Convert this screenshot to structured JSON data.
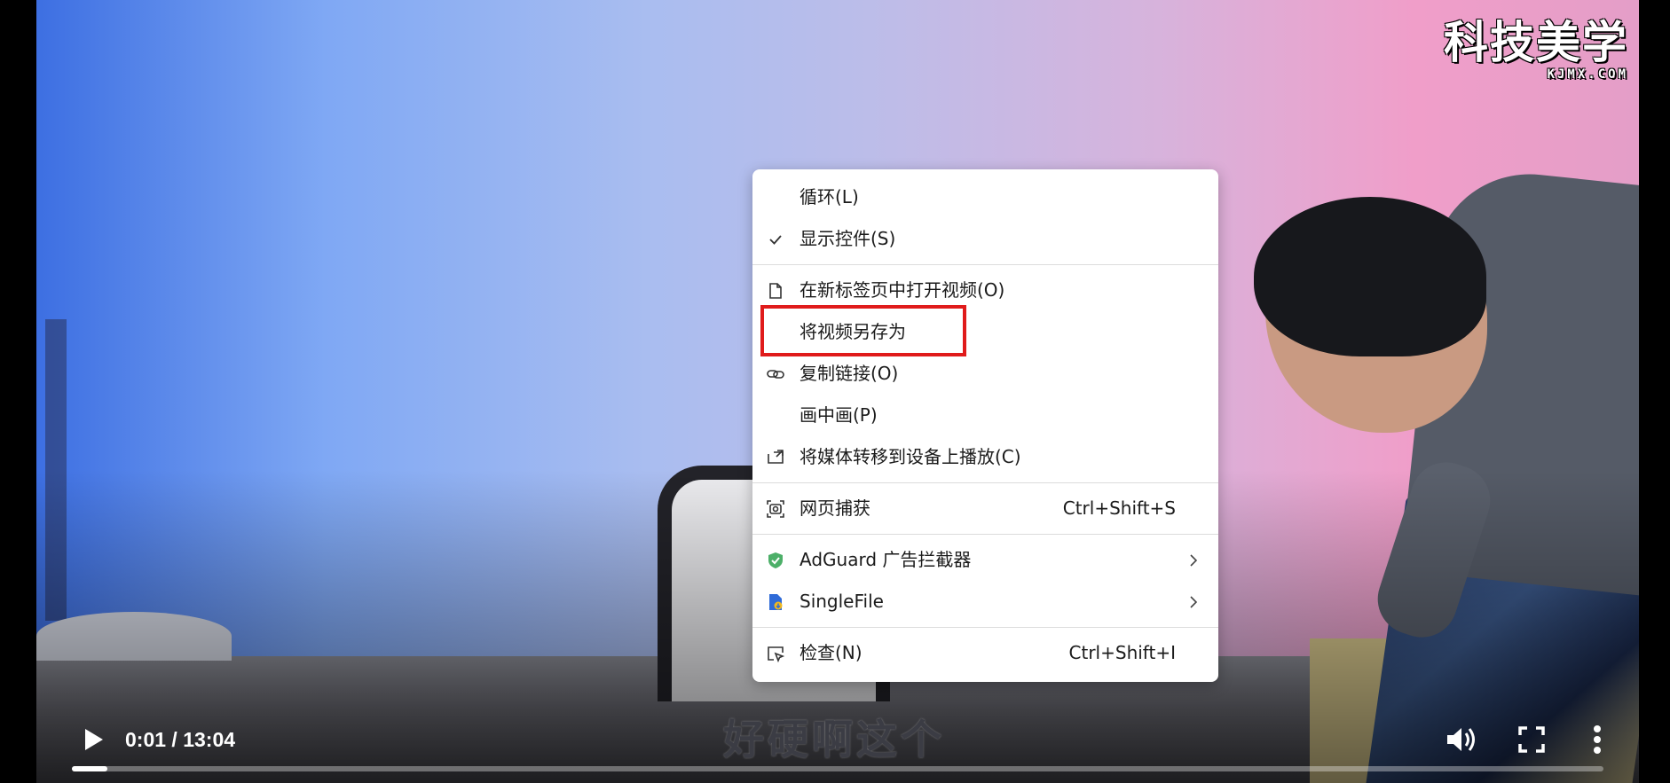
{
  "watermark": {
    "main": "科技美学",
    "sub": "KJMX.COM"
  },
  "subtitle": "好硬啊这个",
  "player": {
    "time": "0:01 / 13:04",
    "progress_fraction": 0.0013,
    "icons": {
      "play": "play-icon",
      "volume": "volume-icon",
      "fullscreen": "fullscreen-icon",
      "more": "more-vertical-icon"
    }
  },
  "context_menu": {
    "loop": {
      "label": "循环(L)"
    },
    "show_controls": {
      "label": "显示控件(S)",
      "checked": true
    },
    "open_new_tab": {
      "label": "在新标签页中打开视频(O)",
      "icon": "document-icon"
    },
    "save_video_as": {
      "label": "将视频另存为",
      "highlighted": true
    },
    "copy_link": {
      "label": "复制链接(O)",
      "icon": "link-icon"
    },
    "pip": {
      "label": "画中画(P)"
    },
    "cast": {
      "label": "将媒体转移到设备上播放(C)",
      "icon": "cast-icon"
    },
    "web_capture": {
      "label": "网页捕获",
      "shortcut": "Ctrl+Shift+S",
      "icon": "capture-icon"
    },
    "adguard": {
      "label": "AdGuard 广告拦截器",
      "icon": "adguard-shield-icon",
      "color": "#4caf68"
    },
    "singlefile": {
      "label": "SingleFile",
      "icon": "singlefile-icon",
      "color": "#2f6bd8"
    },
    "inspect": {
      "label": "检查(N)",
      "shortcut": "Ctrl+Shift+I",
      "icon": "inspect-icon"
    }
  },
  "highlight_color": "#e01b1b"
}
